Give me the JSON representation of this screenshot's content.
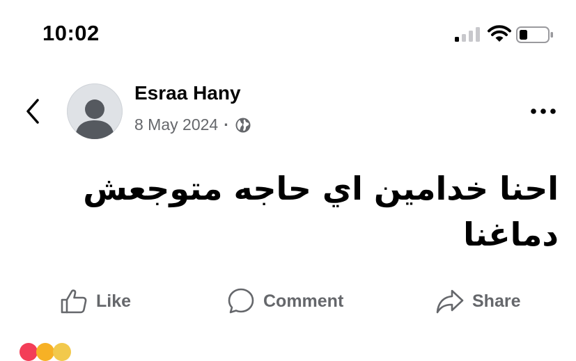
{
  "status_bar": {
    "time": "10:02",
    "icons": [
      "cellular-signal-icon",
      "wifi-icon",
      "battery-icon"
    ]
  },
  "post": {
    "author_name": "Esraa Hany",
    "date": "8 May 2024",
    "separator": "·",
    "audience_icon": "globe-icon",
    "text": "احنا خدامين اي حاجه متوجعش دماغنا"
  },
  "actions": {
    "like_label": "Like",
    "comment_label": "Comment",
    "share_label": "Share"
  },
  "colors": {
    "text_primary": "#050505",
    "text_secondary": "#65676b",
    "avatar_bg": "#dfe2e6"
  }
}
